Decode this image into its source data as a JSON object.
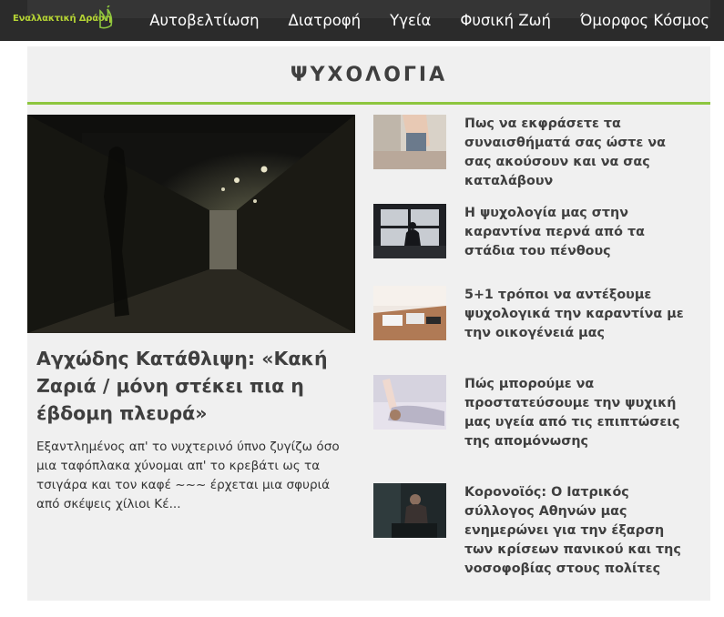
{
  "site": {
    "logo_text": "Εναλλακτική Δράση",
    "brand_color": "#8dc63f",
    "header_bg": "#2b2b2b"
  },
  "nav": {
    "items": [
      "Αυτοβελτίωση",
      "Διατροφή",
      "Υγεία",
      "Φυσική Ζωή",
      "Όμορφος Κόσμος"
    ]
  },
  "section": {
    "title": "ΨΥΧΟΛΟΓΙΑ"
  },
  "featured": {
    "title": "Αγχώδης Κατάθλιψη: «Κακή Ζαριά / μόνη στέκει πια η έβδομη πλευρά»",
    "excerpt": "Εξαντλημένος απ' το νυχτερινό ύπνο ζυγίζω όσο μια ταφόπλακα χύνομαι απ' το κρεβάτι ως τα τσιγάρα και τον καφέ ~~~ έρχεται μια σφυριά από σκέψεις χίλιοι Κέ..."
  },
  "articles": [
    {
      "title": "Πως να εκφράσετε τα συναισθήματά σας ώστε να σας ακούσουν και να σας καταλάβουν"
    },
    {
      "title": "Η ψυχολογία μας στην καραντίνα περνά από τα στάδια του πένθους"
    },
    {
      "title": "5+1 τρόποι να αντέξουμε ψυχολογικά την καραντίνα με την οικογένειά μας"
    },
    {
      "title": "Πώς μπορούμε να προστατεύσουμε την ψυχική μας υγεία από τις επιπτώσεις της απομόνωσης"
    },
    {
      "title": "Κορονοϊός: Ο Ιατρικός σύλλογος Αθηνών μας ενημερώνει για την έξαρση των κρίσεων πανικού και της νοσοφοβίας στους πολίτες"
    }
  ]
}
